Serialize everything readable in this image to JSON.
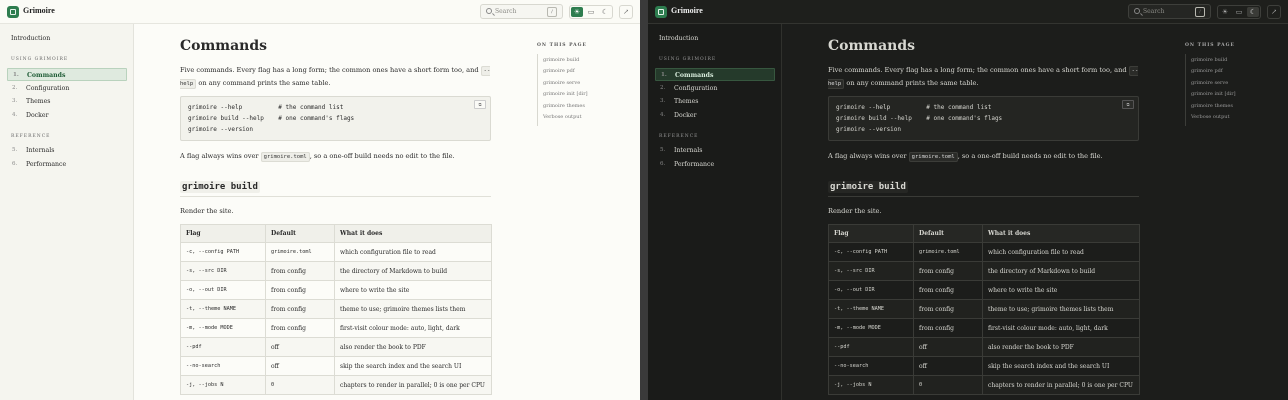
{
  "brand": "Grimoire",
  "search": {
    "placeholder": "Search",
    "shortcut": "/"
  },
  "mode_icons": [
    "sun-icon",
    "monitor-icon",
    "moon-icon"
  ],
  "sidebar": {
    "intro": "Introduction",
    "section1": "Using Grimoire",
    "items1": [
      {
        "num": "1.",
        "label": "Commands"
      },
      {
        "num": "2.",
        "label": "Configuration"
      },
      {
        "num": "3.",
        "label": "Themes"
      },
      {
        "num": "4.",
        "label": "Docker"
      }
    ],
    "section2": "Reference",
    "items2": [
      {
        "num": "5.",
        "label": "Internals"
      },
      {
        "num": "6.",
        "label": "Performance"
      }
    ]
  },
  "page": {
    "title": "Commands",
    "intro_a": "Five commands. Every flag has a long form; the common ones have a short form too, and ",
    "intro_code": "--help",
    "intro_b": " on any command prints the same table.",
    "code_lines": [
      "grimoire --help          # the command list",
      "grimoire build --help    # one command's flags",
      "grimoire --version"
    ],
    "copy_label": "⧉",
    "flag_note_a": "A flag always wins over ",
    "flag_note_code": "grimoire.toml",
    "flag_note_b": ", so a one-off build needs no edit to the file.",
    "section_heading": "grimoire build",
    "section_desc": "Render the site.",
    "table": {
      "headers": [
        "Flag",
        "Default",
        "What it does"
      ],
      "rows": [
        {
          "flag": "-c, --config PATH",
          "default": "grimoire.toml",
          "what": "which configuration file to read"
        },
        {
          "flag": "-s, --src DIR",
          "default": "from config",
          "what": "the directory of Markdown to build"
        },
        {
          "flag": "-o, --out DIR",
          "default": "from config",
          "what": "where to write the site"
        },
        {
          "flag": "-t, --theme NAME",
          "default": "from config",
          "what": "theme to use; grimoire themes lists them"
        },
        {
          "flag": "-m, --mode MODE",
          "default": "from config",
          "what": "first-visit colour mode: auto, light, dark"
        },
        {
          "flag": "--pdf",
          "default": "off",
          "what": "also render the book to PDF"
        },
        {
          "flag": "--no-search",
          "default": "off",
          "what": "skip the search index and the search UI"
        },
        {
          "flag": "-j, --jobs N",
          "default": "0",
          "what": "chapters to render in parallel; 0 is one per CPU"
        }
      ]
    }
  },
  "toc": {
    "title": "On this page",
    "items": [
      "grimoire build",
      "grimoire pdf",
      "grimoire serve",
      "grimoire init [dir]",
      "grimoire themes",
      "Verbose output"
    ]
  }
}
